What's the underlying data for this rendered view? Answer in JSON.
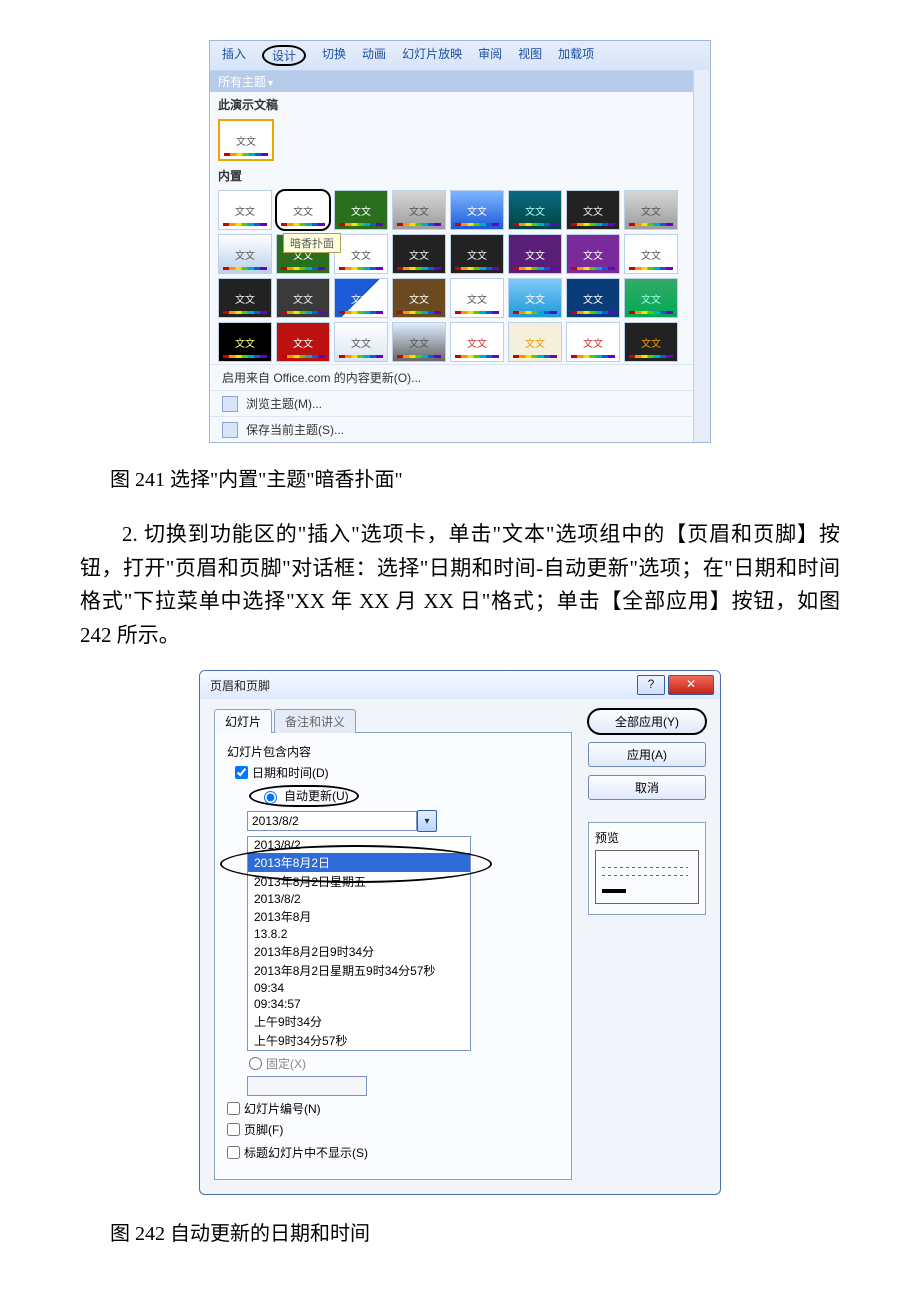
{
  "ppt": {
    "tabs": [
      "插入",
      "设计",
      "切换",
      "动画",
      "幻灯片放映",
      "审阅",
      "视图",
      "加载项"
    ],
    "activeTab": "设计",
    "allThemesLabel": "所有主题",
    "currentDocLabel": "此演示文稿",
    "builtInLabel": "内置",
    "thumbText": "文文",
    "tooltip": "暗香扑面",
    "menu": {
      "officeUpdate": "启用来自 Office.com 的内容更新(O)...",
      "browse": "浏览主题(M)...",
      "save": "保存当前主题(S)..."
    }
  },
  "caption1": "图 241 选择\"内置\"主题\"暗香扑面\"",
  "para1": "2. 切换到功能区的\"插入\"选项卡，单击\"文本\"选项组中的【页眉和页脚】按钮，打开\"页眉和页脚\"对话框：选择\"日期和时间-自动更新\"选项；在\"日期和时间格式\"下拉菜单中选择\"XX 年 XX 月 XX 日\"格式；单击【全部应用】按钮，如图 242 所示。",
  "dlg": {
    "title": "页眉和页脚",
    "tabs": {
      "slide": "幻灯片",
      "notes": "备注和讲义"
    },
    "includeLabel": "幻灯片包含内容",
    "dateLabel": "日期和时间(D)",
    "autoLabel": "自动更新(U)",
    "dateValue": "2013/8/2",
    "fixedLabel": "固定(X)",
    "slideNum": "幻灯片编号(N)",
    "footerChk": "页脚(F)",
    "noTitle": "标题幻灯片中不显示(S)",
    "formats": [
      "2013/8/2",
      "2013年8月2日",
      "2013年8月2日星期五",
      "2013/8/2",
      "2013年8月",
      "13.8.2",
      "2013年8月2日9时34分",
      "2013年8月2日星期五9时34分57秒",
      "09:34",
      "09:34:57",
      "上午9时34分",
      "上午9时34分57秒"
    ],
    "buttons": {
      "applyAll": "全部应用(Y)",
      "apply": "应用(A)",
      "cancel": "取消"
    },
    "previewLabel": "预览"
  },
  "caption2": "图 242 自动更新的日期和时间"
}
